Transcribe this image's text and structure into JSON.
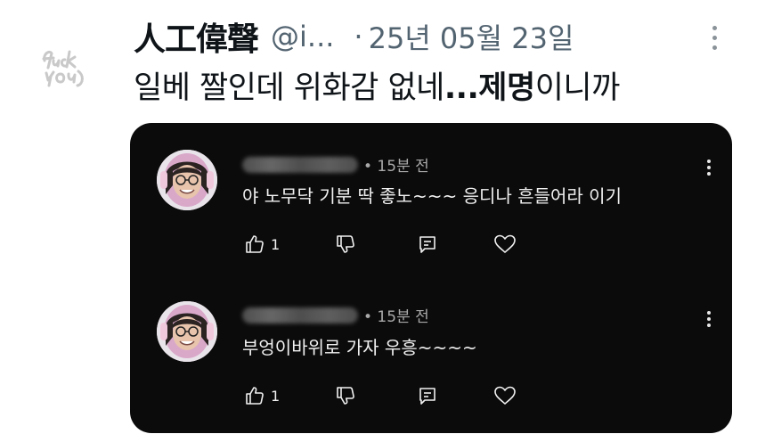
{
  "tweet": {
    "name": "人工偉聲",
    "handle": "@i...",
    "separator": "·",
    "date": "25년 05월 23일",
    "text_before": "일베 짤인데 위화감 없네",
    "text_ellipsis": "...",
    "text_bold": "제명",
    "text_after": "이니까",
    "avatar_logo_text": "fuck you"
  },
  "comments": [
    {
      "author_blurred": true,
      "time": "• 15분 전",
      "text": "야 노무닥 기분 딱 좋노~~~ 응디나 흔들어라 이기",
      "likes": "1"
    },
    {
      "author_blurred": true,
      "time": "• 15분 전",
      "text": "부엉이바위로 가자 우흥~~~~",
      "likes": "1"
    }
  ],
  "icons": [
    "more-vertical-icon",
    "thumb-up-icon",
    "thumb-down-icon",
    "reply-icon",
    "heart-icon"
  ],
  "colors": {
    "card_bg": "#0b0b0b",
    "meta_gray": "#536471",
    "text_white": "#f1f1f1"
  }
}
